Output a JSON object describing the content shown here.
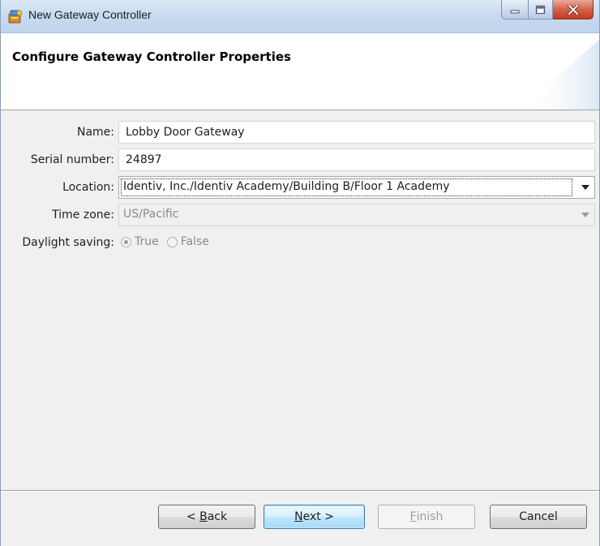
{
  "window": {
    "title": "New Gateway Controller"
  },
  "header": {
    "title": "Configure Gateway Controller Properties"
  },
  "form": {
    "name_label": "Name:",
    "name_value": "Lobby Door Gateway",
    "serial_label": "Serial number:",
    "serial_value": "24897",
    "location_label": "Location:",
    "location_value": "Identiv, Inc./Identiv Academy/Building B/Floor 1 Academy",
    "timezone_label": "Time zone:",
    "timezone_value": "US/Pacific",
    "daylight_label": "Daylight saving:",
    "daylight_options": [
      {
        "label": "True",
        "checked": true
      },
      {
        "label": "False",
        "checked": false
      }
    ]
  },
  "buttons": {
    "back_prefix": "< ",
    "back_mnemonic": "B",
    "back_rest": "ack",
    "next_mnemonic": "N",
    "next_rest": "ext >",
    "finish_mnemonic": "F",
    "finish_rest": "inish",
    "cancel": "Cancel"
  },
  "icons": {
    "app": "gateway-controller-icon",
    "minimize": "minimize-icon",
    "maximize": "maximize-icon",
    "close": "close-icon"
  },
  "colors": {
    "default_button_border": "#3c7fb1",
    "close_button": "#c43b1f"
  }
}
